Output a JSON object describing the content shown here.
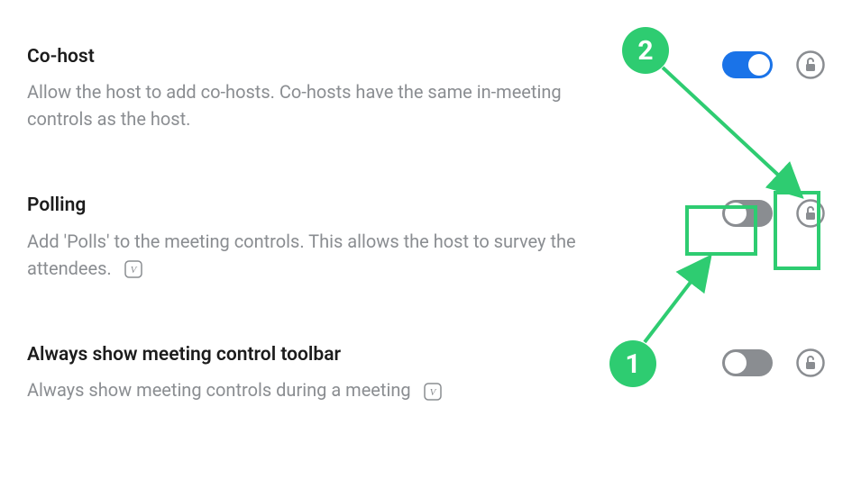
{
  "colors": {
    "accent": "#2ecc71",
    "toggle_on": "#1a73e8",
    "toggle_off": "#8a8d91",
    "text_primary": "#1c1c1c",
    "text_secondary": "#8a8d91"
  },
  "settings": [
    {
      "id": "co_host",
      "title": "Co-host",
      "description": "Allow the host to add co-hosts. Co-hosts have the same in-meeting controls as the host.",
      "toggle": "on",
      "locked": false,
      "has_version_badge": false
    },
    {
      "id": "polling",
      "title": "Polling",
      "description": "Add 'Polls' to the meeting controls. This allows the host to survey the attendees.",
      "toggle": "off",
      "locked": false,
      "has_version_badge": true
    },
    {
      "id": "always_show_toolbar",
      "title": "Always show meeting control toolbar",
      "description": "Always show meeting controls during a meeting",
      "toggle": "off",
      "locked": false,
      "has_version_badge": true
    }
  ],
  "version_badge_label": "V",
  "annotations": {
    "callout1": "1",
    "callout2": "2"
  }
}
